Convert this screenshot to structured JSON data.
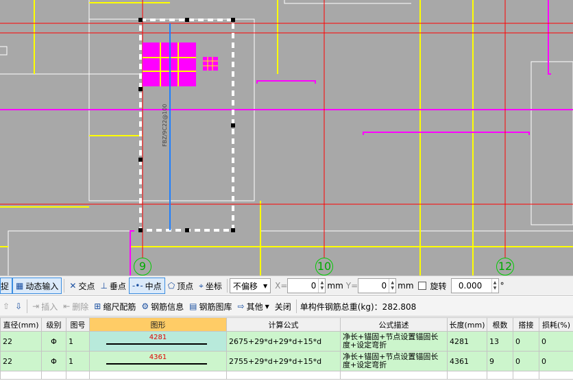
{
  "canvas": {
    "axis_labels": [
      "9",
      "10",
      "12"
    ],
    "rebar_label": "FBZ/9C22@100"
  },
  "toolbar1": {
    "capture": "捉",
    "dynamic_input": "动态输入",
    "intersection": "交点",
    "perpendicular": "垂点",
    "midpoint": "中点",
    "vertex": "顶点",
    "coordinate": "坐标",
    "offset_mode": "不偏移",
    "x_label": "X=",
    "x_value": "0",
    "y_label": "Y=",
    "y_value": "0",
    "unit": "mm",
    "rotate_label": "旋转",
    "rotate_value": "0.000",
    "degree": "°"
  },
  "toolbar2": {
    "insert": "插入",
    "delete": "删除",
    "scale_rebar": "缩尺配筋",
    "rebar_info": "钢筋信息",
    "rebar_library": "钢筋图库",
    "other": "其他",
    "close": "关闭",
    "total_weight": "单构件钢筋总重(kg)：282.808"
  },
  "table": {
    "headers": [
      "直径(mm)",
      "级别",
      "图号",
      "图形",
      "计算公式",
      "公式描述",
      "长度(mm)",
      "根数",
      "搭接",
      "损耗(%)"
    ],
    "rows": [
      {
        "diameter": "22",
        "grade": "Φ",
        "fig_no": "1",
        "shape_value": "4281",
        "formula": "2675+29*d+29*d+15*d",
        "desc": "净长+锚固+节点设置锚固长度+设定弯折",
        "length": "4281",
        "count": "13",
        "lap": "0",
        "loss": "0"
      },
      {
        "diameter": "22",
        "grade": "Φ",
        "fig_no": "1",
        "shape_value": "4361",
        "formula": "2755+29*d+29*d+15*d",
        "desc": "净长+锚固+节点设置锚固长度+设定弯折",
        "length": "4361",
        "count": "9",
        "lap": "0",
        "loss": "0"
      }
    ]
  },
  "colors": {
    "canvas_bg": "#a8a8a8",
    "axis_red": "#ff0000",
    "beam_yellow": "#ffff00",
    "beam_magenta": "#ff00ff",
    "rebar_blue": "#1e7fff",
    "axis_label_green": "#00aa00",
    "selected_header": "#ffcc66",
    "row_green": "#ccf5cc"
  }
}
